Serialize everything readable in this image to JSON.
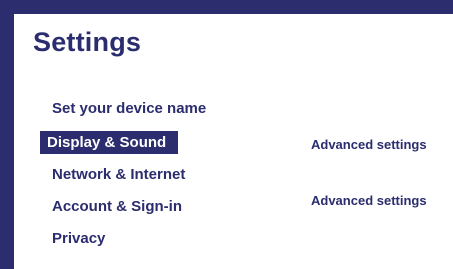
{
  "page": {
    "title": "Settings"
  },
  "menu": {
    "items": [
      {
        "label": "Set your device name"
      },
      {
        "label": "Display & Sound"
      },
      {
        "label": "Network & Internet"
      },
      {
        "label": "Account & Sign-in"
      },
      {
        "label": "Privacy"
      }
    ],
    "selected_index": 1
  },
  "side_links": [
    {
      "label": "Advanced settings"
    },
    {
      "label": "Advanced settings"
    }
  ],
  "colors": {
    "accent": "#2b2d6e",
    "background": "#ffffff"
  }
}
